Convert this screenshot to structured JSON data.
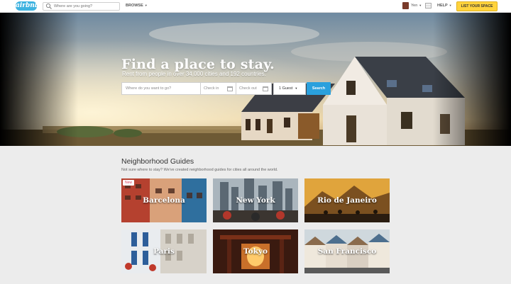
{
  "nav": {
    "logo_text": "airbnb",
    "search_placeholder": "Where are you going?",
    "browse_label": "BROWSE",
    "user_name": "Yen",
    "help_label": "HELP",
    "list_space_label": "LIST YOUR SPACE"
  },
  "hero": {
    "title": "Find a place to stay.",
    "subtitle": "Rent from people in over 34,000 cities and 192 countries.",
    "where_placeholder": "Where do you want to go?",
    "checkin_placeholder": "Check in",
    "checkout_placeholder": "Check out",
    "guests_value": "1 Guest",
    "search_button": "Search"
  },
  "guides": {
    "title": "Neighborhood Guides",
    "subtitle": "Not sure where to stay? We've created neighborhood guides for cities all around the world.",
    "new_badge": "New",
    "cities": [
      {
        "name": "Barcelona",
        "palette": [
          "#b5412f",
          "#d9a17a",
          "#2f6f9e"
        ]
      },
      {
        "name": "New York",
        "palette": [
          "#8c9ba8",
          "#5b6873",
          "#b2372b"
        ]
      },
      {
        "name": "Rio de Janeiro",
        "palette": [
          "#e0a43c",
          "#7b5020",
          "#2a1c10"
        ]
      },
      {
        "name": "Paris",
        "palette": [
          "#e9ecef",
          "#2d5e9a",
          "#c0392b"
        ]
      },
      {
        "name": "Tokyo",
        "palette": [
          "#3a1a10",
          "#c9702a",
          "#ffcb6b"
        ]
      },
      {
        "name": "San Francisco",
        "palette": [
          "#cfd8dd",
          "#8a6b4d",
          "#4d6f8e"
        ]
      }
    ]
  },
  "colors": {
    "brand": "#3fb3e0",
    "list_space": "#ffd33d",
    "search_button": "#2aa0dd"
  }
}
